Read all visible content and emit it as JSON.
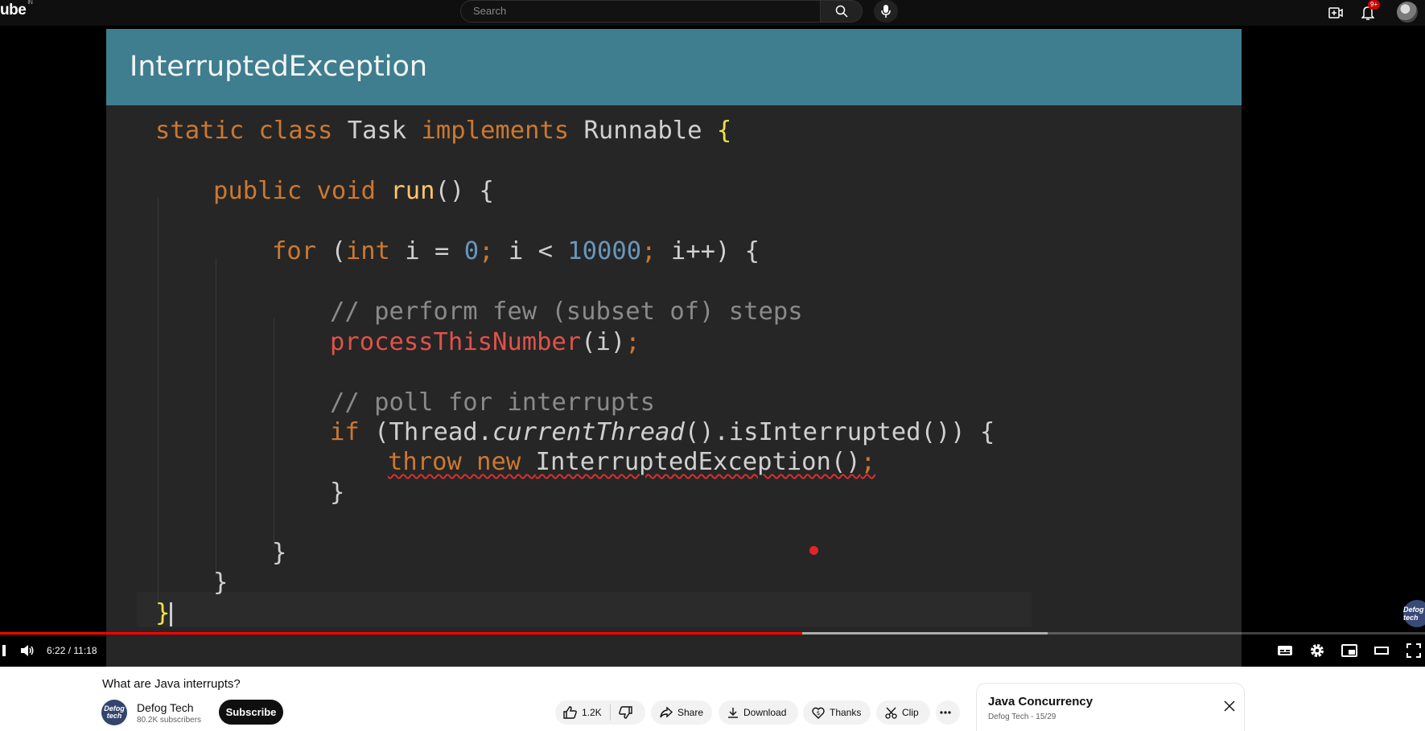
{
  "header": {
    "logo_text": "ube",
    "region_code": "IN",
    "search_placeholder": "Search",
    "notification_count": "9+",
    "icons": [
      "search-icon",
      "mic-icon",
      "create-icon",
      "bell-icon",
      "avatar"
    ]
  },
  "slide": {
    "title": "InterruptedException",
    "header_color": "#3e7e8e",
    "code_lines": [
      "static class Task implements Runnable {",
      "public void run() {",
      "for (int i = 0; i < 10000; i++) {",
      "// perform few (subset of) steps",
      "processThisNumber(i);",
      "// poll for interrupts",
      "if (Thread.currentThread().isInterrupted()) {",
      "throw new InterruptedException();",
      "}",
      "}",
      "}",
      "}"
    ],
    "watermark": "Defog tech"
  },
  "player": {
    "current_time": "6:22",
    "duration": "11:18",
    "time_display": "6:22 / 11:18",
    "progress_fraction": 0.563,
    "buffered_fraction": 0.735,
    "controls": [
      "play-icon",
      "volume-icon",
      "subtitles-icon",
      "settings-icon",
      "miniplayer-icon",
      "theater-icon",
      "fullscreen-icon"
    ],
    "accent_color": "#ff0000"
  },
  "video": {
    "title": "What are Java interrupts?",
    "channel_name": "Defog Tech",
    "channel_avatar_text": "Defog tech",
    "subscribers": "80.2K subscribers",
    "subscribe_label": "Subscribe",
    "like_count": "1.2K",
    "share_label": "Share",
    "download_label": "Download",
    "thanks_label": "Thanks",
    "clip_label": "Clip"
  },
  "playlist": {
    "title": "Java Concurrency",
    "subtitle": "Defog Tech - 15/29"
  }
}
